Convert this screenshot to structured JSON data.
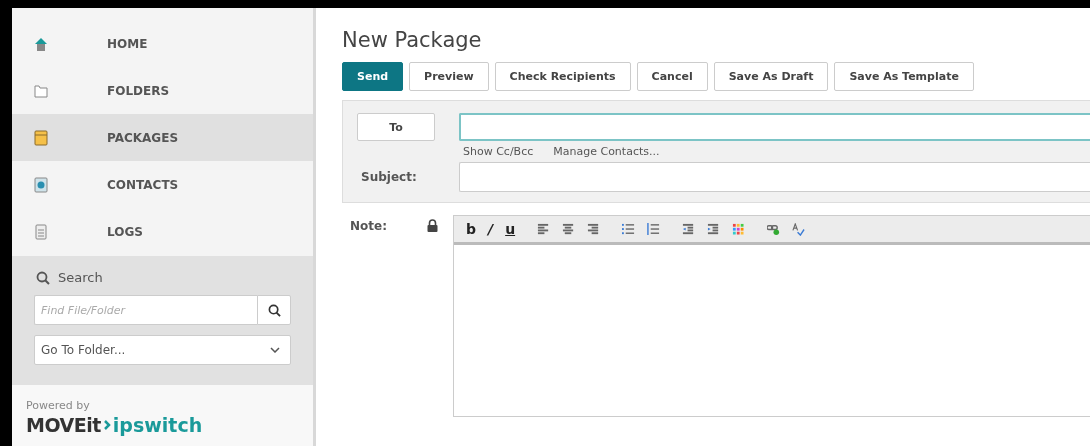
{
  "sidebar": {
    "items": [
      {
        "label": "HOME",
        "kind": "home",
        "selected": false
      },
      {
        "label": "FOLDERS",
        "kind": "folder",
        "selected": false
      },
      {
        "label": "PACKAGES",
        "kind": "package",
        "selected": true
      },
      {
        "label": "CONTACTS",
        "kind": "contacts",
        "selected": false
      },
      {
        "label": "LOGS",
        "kind": "logs",
        "selected": false
      }
    ],
    "search": {
      "heading": "Search",
      "placeholder": "Find File/Folder",
      "goto": "Go To Folder..."
    },
    "powered_by": "Powered by",
    "logo": {
      "left": "MOVEit",
      "right": "ipswitch"
    }
  },
  "page": {
    "title": "New Package",
    "buttons": [
      {
        "label": "Send",
        "primary": true
      },
      {
        "label": "Preview",
        "primary": false
      },
      {
        "label": "Check Recipients",
        "primary": false
      },
      {
        "label": "Cancel",
        "primary": false
      },
      {
        "label": "Save As Draft",
        "primary": false
      },
      {
        "label": "Save As Template",
        "primary": false
      }
    ],
    "to_button": "To",
    "links": [
      "Show Cc/Bcc",
      "Manage Contacts..."
    ],
    "subject_label": "Subject:",
    "note_label": "Note:",
    "toolbar": [
      {
        "kind": "bold",
        "text": "b"
      },
      {
        "kind": "italic",
        "text": "/"
      },
      {
        "kind": "underline",
        "text": "u"
      },
      {
        "kind": "align-left"
      },
      {
        "kind": "align-center"
      },
      {
        "kind": "align-right"
      },
      {
        "kind": "bullet-list"
      },
      {
        "kind": "numbered-list"
      },
      {
        "kind": "outdent"
      },
      {
        "kind": "indent"
      },
      {
        "kind": "color"
      },
      {
        "kind": "link"
      },
      {
        "kind": "spell"
      }
    ]
  }
}
